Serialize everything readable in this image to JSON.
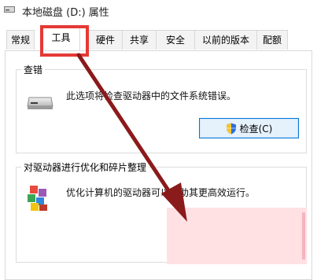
{
  "window": {
    "title": "本地磁盘 (D:) 属性",
    "icon": "drive-icon"
  },
  "tabs": [
    {
      "label": "常规"
    },
    {
      "label": "工具",
      "active": true
    },
    {
      "label": "硬件"
    },
    {
      "label": "共享"
    },
    {
      "label": "安全"
    },
    {
      "label": "以前的版本"
    },
    {
      "label": "配额"
    }
  ],
  "error_check": {
    "legend": "查错",
    "description": "此选项将检查驱动器中的文件系统错误。",
    "button_label": "检查(C)",
    "button_icon": "uac-shield-icon"
  },
  "optimize": {
    "legend": "对驱动器进行优化和碎片整理",
    "description": "优化计算机的驱动器可以帮助其更高效运行。",
    "icon": "defrag-icon"
  },
  "annotation": {
    "highlight_color": "#e53935",
    "arrow_color": "#8b1a1a"
  }
}
